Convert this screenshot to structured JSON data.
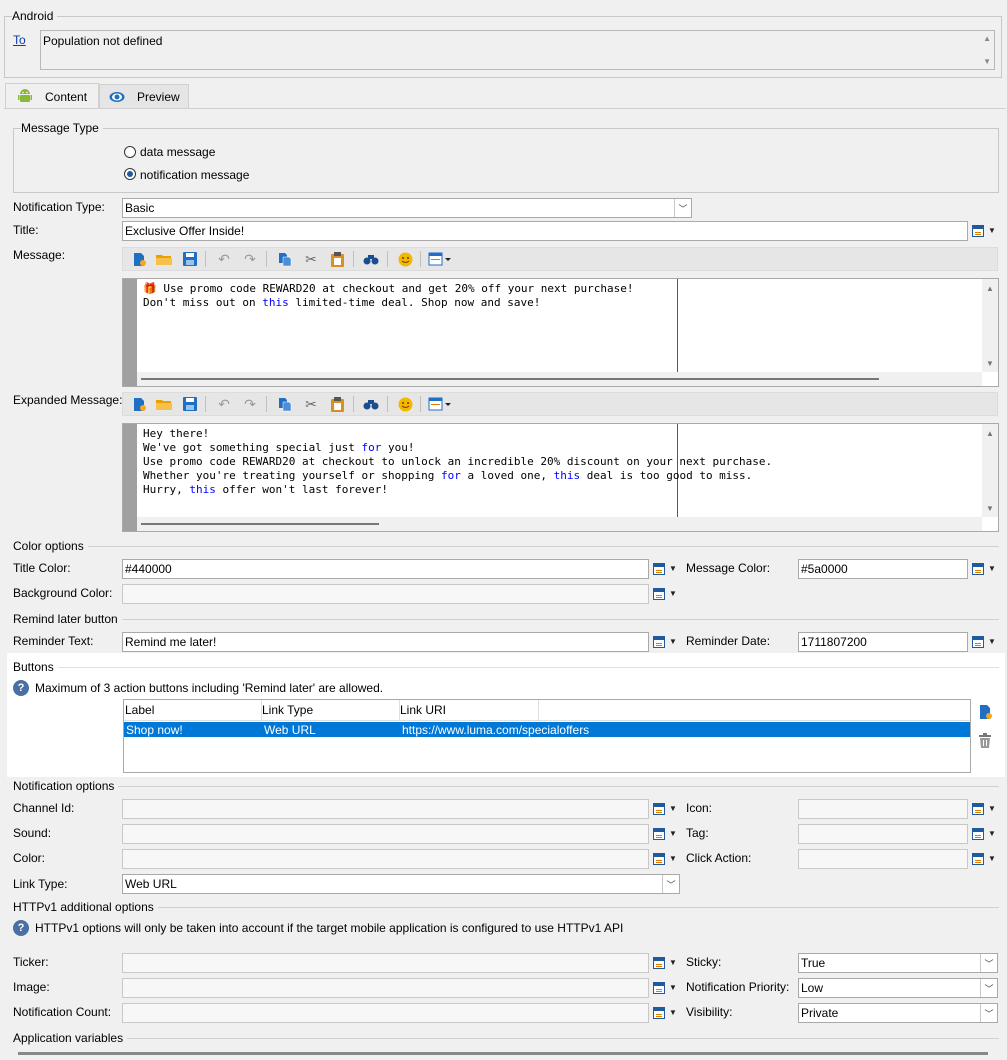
{
  "android": {
    "group_title": "Android",
    "to_link": "To",
    "population": "Population not defined"
  },
  "tabs": [
    {
      "label": "Content",
      "icon": "android-icon",
      "active": true
    },
    {
      "label": "Preview",
      "icon": "eye-icon",
      "active": false
    }
  ],
  "message_type": {
    "group_title": "Message Type",
    "options": [
      {
        "label": "data message",
        "selected": false
      },
      {
        "label": "notification message",
        "selected": true
      }
    ]
  },
  "notification_type": {
    "label": "Notification Type:",
    "value": "Basic"
  },
  "title": {
    "label": "Title:",
    "value": "Exclusive Offer Inside!"
  },
  "message": {
    "label": "Message:",
    "lines": [
      "🎁 Use promo code REWARD20 at checkout and get 20% off your next purchase!",
      "Don't miss out on this limited-time deal. Shop now and save!"
    ]
  },
  "expanded_message": {
    "label": "Expanded Message:",
    "lines": [
      "Hey there!",
      "We've got something special just for you!",
      "Use promo code REWARD20 at checkout to unlock an incredible 20% discount on your next purchase.",
      "Whether you're treating yourself or shopping for a loved one, this deal is too good to miss.",
      "Hurry, this offer won't last forever!"
    ]
  },
  "toolbar_icons": [
    "new-icon",
    "open-folder-icon",
    "save-icon",
    "undo-icon",
    "redo-icon",
    "copy-icon",
    "cut-icon",
    "paste-icon",
    "find-icon",
    "emoji-icon",
    "insert-field-icon"
  ],
  "color_options": {
    "group_title": "Color options",
    "title_color_label": "Title Color:",
    "title_color_value": "#440000",
    "message_color_label": "Message Color:",
    "message_color_value": "#5a0000",
    "background_color_label": "Background Color:",
    "background_color_value": ""
  },
  "remind_later": {
    "group_title": "Remind later button",
    "reminder_text_label": "Reminder Text:",
    "reminder_text_value": "Remind me later!",
    "reminder_date_label": "Reminder Date:",
    "reminder_date_value": "1711807200"
  },
  "buttons": {
    "group_title": "Buttons",
    "info": "Maximum of 3 action buttons including 'Remind later' are allowed.",
    "columns": [
      "Label",
      "Link Type",
      "Link URI"
    ],
    "rows": [
      {
        "label": "Shop now!",
        "link_type": "Web URL",
        "link_uri": "https://www.luma.com/specialoffers"
      }
    ]
  },
  "notification_options": {
    "group_title": "Notification options",
    "channel_id_label": "Channel Id:",
    "icon_label": "Icon:",
    "sound_label": "Sound:",
    "tag_label": "Tag:",
    "color_label": "Color:",
    "click_action_label": "Click Action:",
    "link_type_label": "Link Type:",
    "link_type_value": "Web URL"
  },
  "httpv1": {
    "group_title": "HTTPv1 additional options",
    "info": "HTTPv1 options will only be taken into account if the target mobile application is configured to use HTTPv1 API",
    "ticker_label": "Ticker:",
    "sticky_label": "Sticky:",
    "sticky_value": "True",
    "image_label": "Image:",
    "priority_label": "Notification Priority:",
    "priority_value": "Low",
    "count_label": "Notification Count:",
    "visibility_label": "Visibility:",
    "visibility_value": "Private"
  },
  "app_variables": {
    "group_title": "Application variables"
  }
}
